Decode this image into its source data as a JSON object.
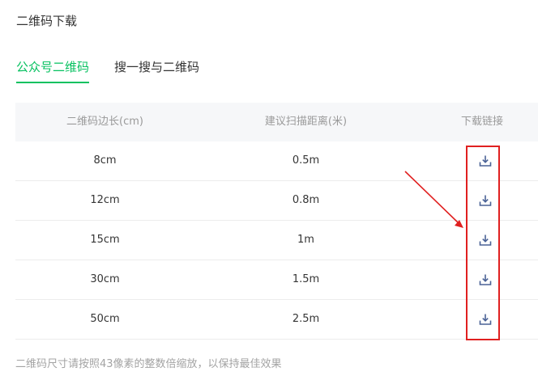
{
  "page": {
    "title": "二维码下载"
  },
  "tabs": [
    {
      "label": "公众号二维码",
      "active": true
    },
    {
      "label": "搜一搜与二维码",
      "active": false
    }
  ],
  "table": {
    "headers": [
      "二维码边长(cm)",
      "建议扫描距离(米)",
      "下载链接"
    ],
    "rows": [
      {
        "size": "8cm",
        "distance": "0.5m",
        "link_icon": "download-icon"
      },
      {
        "size": "12cm",
        "distance": "0.8m",
        "link_icon": "download-icon"
      },
      {
        "size": "15cm",
        "distance": "1m",
        "link_icon": "download-icon"
      },
      {
        "size": "30cm",
        "distance": "1.5m",
        "link_icon": "download-icon"
      },
      {
        "size": "50cm",
        "distance": "2.5m",
        "link_icon": "download-icon"
      }
    ]
  },
  "footnote": "二维码尺寸请按照43像素的整数倍缩放，以保持最佳效果",
  "colors": {
    "accent": "#07c160",
    "header_bg": "#f6f7f9",
    "icon": "#4a6296",
    "annotation": "#e02020"
  }
}
